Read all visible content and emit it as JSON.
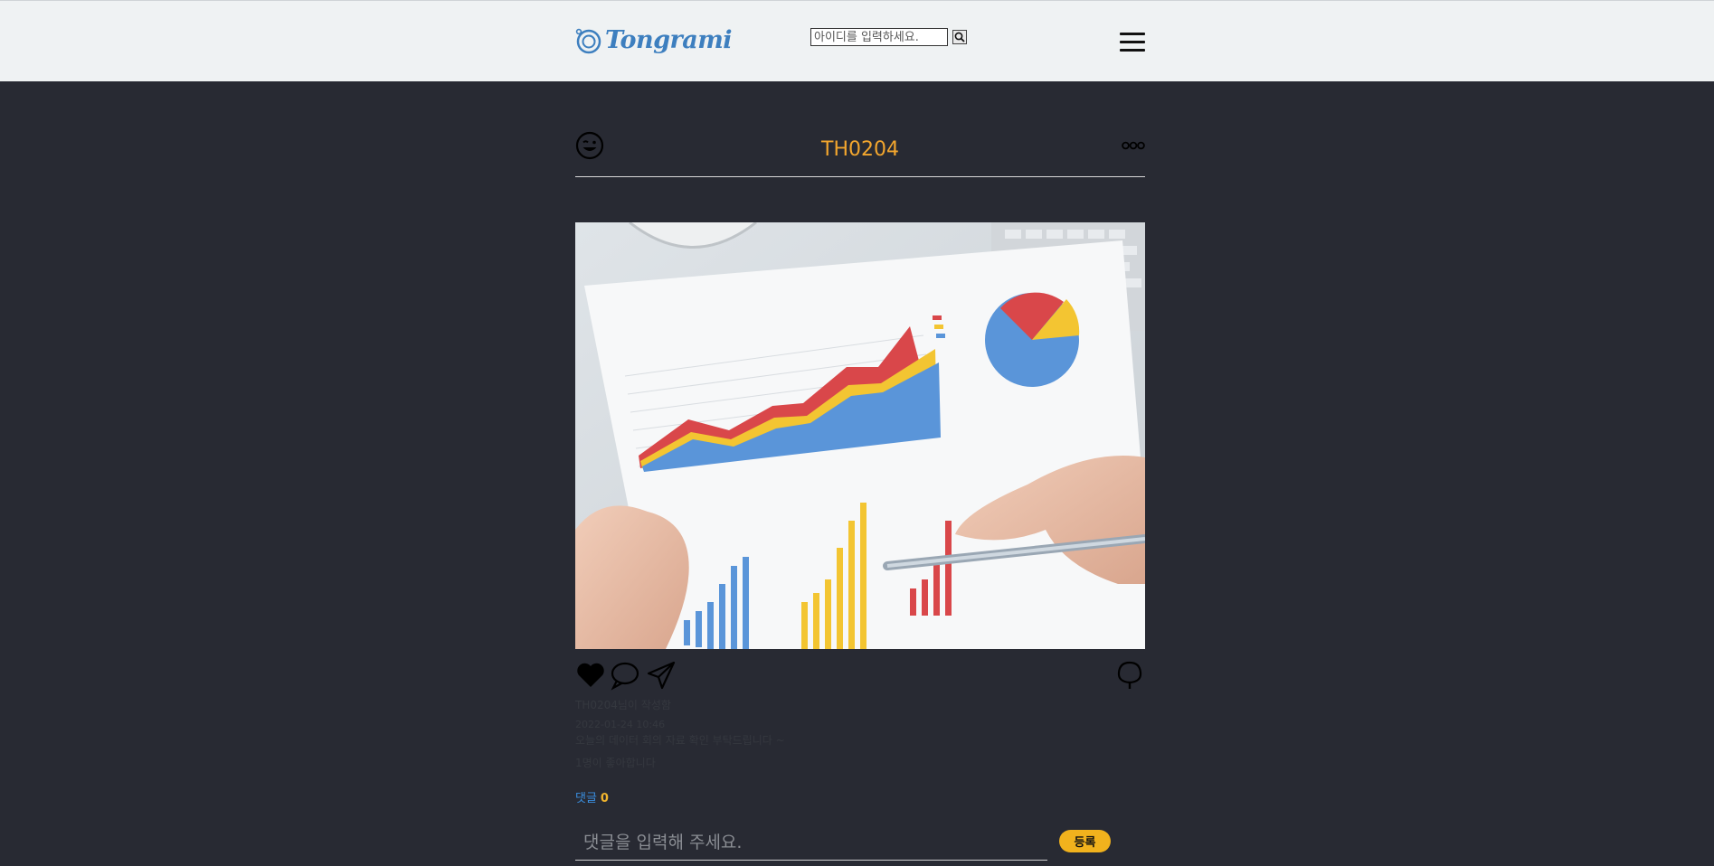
{
  "header": {
    "logo_text": "Tongrami",
    "search": {
      "placeholder": "아이디를 입력하세요.",
      "value": ""
    },
    "search_icon": "search-icon",
    "menu_icon": "hamburger-menu-icon"
  },
  "post": {
    "avatar_icon": "smiley-wink-icon",
    "username": "TH0204",
    "more_icon": "more-options-icon",
    "photo_alt": "hands-with-pen-over-printed-charts",
    "actions": {
      "like_icon": "heart-icon",
      "comment_icon": "speech-bubble-icon",
      "share_icon": "paper-plane-icon",
      "save_icon": "tree-icon"
    },
    "author_line": "TH0204님이 작성함",
    "date": "2022-01-24 10:46",
    "caption": "오늘의 데이터 회의 자료 확인 부탁드립니다 ~",
    "likes_text": "1명이 좋아합니다"
  },
  "comments": {
    "label": "댓글",
    "count": "0",
    "input_placeholder": "댓글을 입력해 주세요.",
    "submit_label": "등록"
  },
  "colors": {
    "page_bg": "#282a33",
    "header_bg": "#eff2f3",
    "accent_yellow": "#f1b21d",
    "username": "#f3a62e",
    "link_blue": "#3a8fe0",
    "logo_blue": "#3d7fbf"
  }
}
